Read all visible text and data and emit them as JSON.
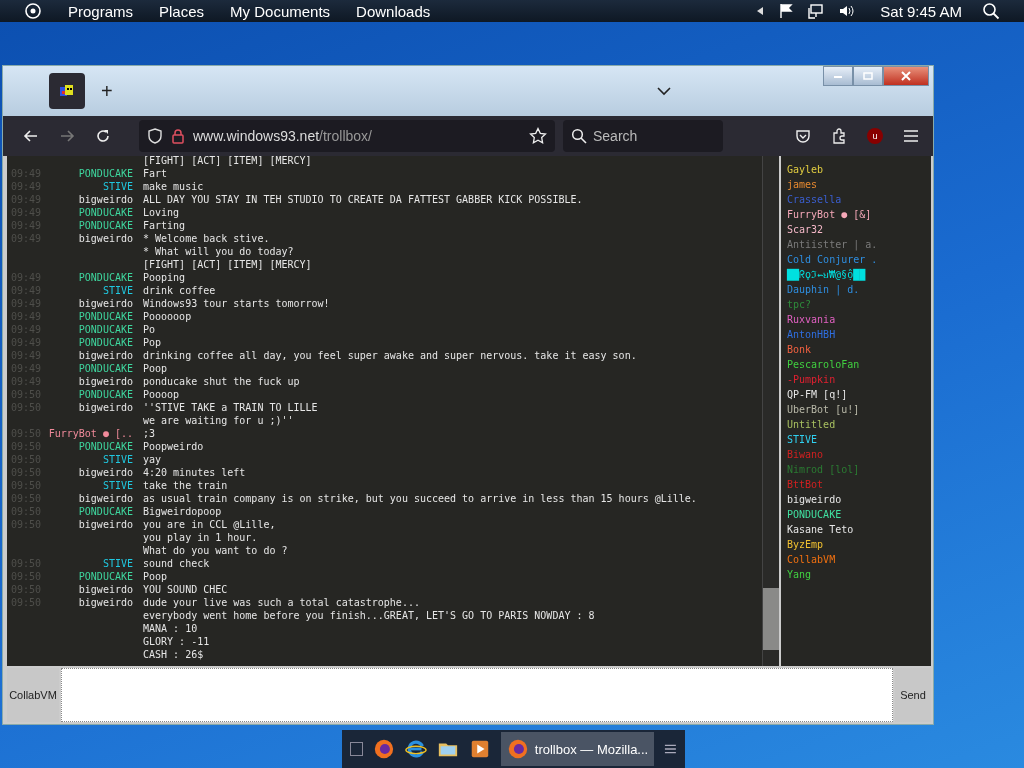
{
  "top_bar": {
    "menu": [
      "Programs",
      "Places",
      "My Documents",
      "Downloads"
    ],
    "clock": "Sat 9:45 AM"
  },
  "browser": {
    "tab": {
      "selected": true
    },
    "new_tab": "+",
    "url_host": "www.windows93.net",
    "url_path": "/trollbox/",
    "search": {
      "placeholder": "Search"
    },
    "extension_badge": "u"
  },
  "chat": {
    "messages": [
      {
        "lines": [
          "[FIGHT] [ACT] [ITEM] [MERCY]"
        ]
      },
      {
        "time": "09:49",
        "user": "PONDUCAKE",
        "color": "#3ed69e",
        "lines": [
          "Fart"
        ]
      },
      {
        "time": "09:49",
        "user": "STIVE",
        "color": "#20c8e0",
        "lines": [
          "make music"
        ]
      },
      {
        "time": "09:49",
        "user": "bigweirdo",
        "lines": [
          "ALL DAY YOU STAY IN TEH STUDIO TO CREATE DA FATTEST GABBER KICK POSSIBLE."
        ]
      },
      {
        "time": "09:49",
        "user": "PONDUCAKE",
        "color": "#3ed69e",
        "lines": [
          "Loving"
        ]
      },
      {
        "time": "09:49",
        "user": "PONDUCAKE",
        "color": "#3ed69e",
        "lines": [
          "Farting"
        ]
      },
      {
        "time": "09:49",
        "user": "bigweirdo",
        "lines": [
          "* Welcome back stive.",
          "* What will you do today?",
          "[FIGHT] [ACT] [ITEM] [MERCY]"
        ]
      },
      {
        "time": "09:49",
        "user": "PONDUCAKE",
        "color": "#3ed69e",
        "lines": [
          "Pooping"
        ]
      },
      {
        "time": "09:49",
        "user": "STIVE",
        "color": "#20c8e0",
        "lines": [
          "drink coffee"
        ]
      },
      {
        "time": "09:49",
        "user": "bigweirdo",
        "lines": [
          "Windows93 tour starts tomorrow!"
        ]
      },
      {
        "time": "09:49",
        "user": "PONDUCAKE",
        "color": "#3ed69e",
        "lines": [
          "Poooooop"
        ]
      },
      {
        "time": "09:49",
        "user": "PONDUCAKE",
        "color": "#3ed69e",
        "lines": [
          "Po"
        ]
      },
      {
        "time": "09:49",
        "user": "PONDUCAKE",
        "color": "#3ed69e",
        "lines": [
          "Pop"
        ]
      },
      {
        "time": "09:49",
        "user": "bigweirdo",
        "lines": [
          "drinking coffee all day, you feel super awake and super nervous. take it easy son."
        ]
      },
      {
        "time": "09:49",
        "user": "PONDUCAKE",
        "color": "#3ed69e",
        "lines": [
          "Poop"
        ]
      },
      {
        "time": "09:49",
        "user": "bigweirdo",
        "lines": [
          "ponducake shut the fuck up"
        ]
      },
      {
        "time": "09:50",
        "user": "PONDUCAKE",
        "color": "#3ed69e",
        "lines": [
          "Poooop"
        ]
      },
      {
        "time": "09:50",
        "user": "bigweirdo",
        "lines": [
          "''STIVE TAKE a TRAIN TO LILLE",
          "we are waiting for u ;)''"
        ]
      },
      {
        "time": "09:50",
        "user": "FurryBot ● [..",
        "color": "#f08a9a",
        "lines": [
          ";3"
        ]
      },
      {
        "time": "09:50",
        "user": "PONDUCAKE",
        "color": "#3ed69e",
        "lines": [
          "Poopweirdo"
        ]
      },
      {
        "time": "09:50",
        "user": "STIVE",
        "color": "#20c8e0",
        "lines": [
          "yay"
        ]
      },
      {
        "time": "09:50",
        "user": "bigweirdo",
        "lines": [
          "4:20 minutes left"
        ]
      },
      {
        "time": "09:50",
        "user": "STIVE",
        "color": "#20c8e0",
        "lines": [
          "take the train"
        ]
      },
      {
        "time": "09:50",
        "user": "bigweirdo",
        "lines": [
          "as usual train company is on strike, but you succeed to arrive in less than 15 hours @Lille."
        ]
      },
      {
        "time": "09:50",
        "user": "PONDUCAKE",
        "color": "#3ed69e",
        "lines": [
          "Bigweirdopoop"
        ]
      },
      {
        "time": "09:50",
        "user": "bigweirdo",
        "lines": [
          "you are in CCL @Lille,",
          "you play in 1 hour.",
          "What do you want to do ?"
        ]
      },
      {
        "time": "09:50",
        "user": "STIVE",
        "color": "#20c8e0",
        "lines": [
          "sound check"
        ]
      },
      {
        "time": "09:50",
        "user": "PONDUCAKE",
        "color": "#3ed69e",
        "lines": [
          "Poop"
        ]
      },
      {
        "time": "09:50",
        "user": "bigweirdo",
        "lines": [
          "YOU SOUND CHEC"
        ]
      },
      {
        "time": "09:50",
        "user": "bigweirdo",
        "lines": [
          "dude your live was such a total catastrophe...",
          "everybody went home before you finish...GREAT, LET'S GO TO PARIS NOWDAY : 8",
          "MANA : 10",
          "GLORY : -11",
          "CASH : 26$"
        ]
      }
    ]
  },
  "users": [
    {
      "name": "Gayleb",
      "color": "#e0cc40"
    },
    {
      "name": "james",
      "color": "#e88a30"
    },
    {
      "name": "Crassella",
      "color": "#3a5ed0"
    },
    {
      "name": "FurryBot ● [&]",
      "color": "#f5a8b8"
    },
    {
      "name": "Scar32",
      "color": "#f5b8c8"
    },
    {
      "name": "Antiistter | a.",
      "color": "#7a7a7a"
    },
    {
      "name": "Cold Conjurer .",
      "color": "#2e8ee0"
    },
    {
      "name": "██ᖇϙℑ⇜ꞟ₩@§ộ██",
      "color": "#00e0e0"
    },
    {
      "name": "Dauphin | d.",
      "color": "#2e8ee0"
    },
    {
      "name": "tpc?",
      "color": "#2e8a3a"
    },
    {
      "name": "Ruxvania",
      "color": "#e060c0"
    },
    {
      "name": "AntonHBH",
      "color": "#2e6ee0"
    },
    {
      "name": "Bonk",
      "color": "#f06040"
    },
    {
      "name": "PescaroloFan",
      "color": "#40d040"
    },
    {
      "name": "-Pumpkin",
      "color": "#e02030"
    },
    {
      "name": "QP-FM [q!]"
    },
    {
      "name": "UberBot [u!]",
      "color": "#b8b8a8"
    },
    {
      "name": "Untitled",
      "color": "#a8c060"
    },
    {
      "name": "STIVE",
      "color": "#30d0f0"
    },
    {
      "name": "Biwano",
      "color": "#d02020"
    },
    {
      "name": "Nimrod [lol]",
      "color": "#2a7a32"
    },
    {
      "name": "BttBot",
      "color": "#d02020"
    },
    {
      "name": "bigweirdo"
    },
    {
      "name": "PONDUCAKE",
      "color": "#40e0a0"
    },
    {
      "name": "Kasane Teto"
    },
    {
      "name": "ByzEmp",
      "color": "#f0c030"
    },
    {
      "name": "CollabVM",
      "color": "#f07010"
    },
    {
      "name": "Yang",
      "color": "#40d040"
    }
  ],
  "input": {
    "left_button": "CollabVM",
    "send_button": "Send"
  },
  "taskbar": {
    "task": "trollbox — Mozilla..."
  }
}
